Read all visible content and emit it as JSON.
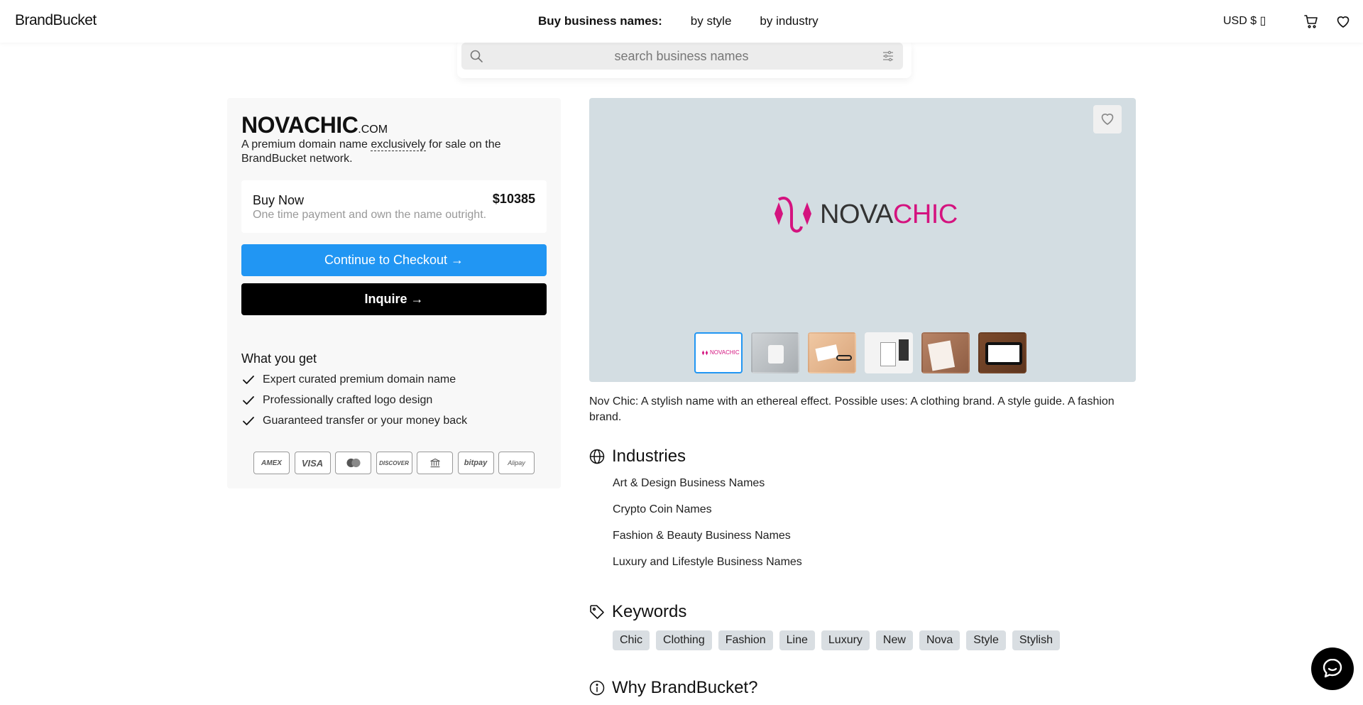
{
  "header": {
    "logo": "BrandBucket",
    "nav_title": "Buy business names:",
    "nav_links": [
      "by style",
      "by industry"
    ],
    "currency": "USD $ ▯"
  },
  "search": {
    "placeholder": "search business names"
  },
  "domain": {
    "name": "NOVACHIC",
    "tld": ".COM",
    "desc_before": "A premium domain name ",
    "desc_emph": "exclusively",
    "desc_after": " for sale on the BrandBucket network."
  },
  "buy": {
    "label": "Buy Now",
    "price": "$10385",
    "sub": "One time payment and own the name outright."
  },
  "buttons": {
    "checkout": "Continue to Checkout →",
    "inquire": "Inquire →"
  },
  "what_you_get": {
    "title": "What you get",
    "items": [
      "Expert curated premium domain name",
      "Professionally crafted logo design",
      "Guaranteed transfer or your money back"
    ]
  },
  "payments": [
    "AMEX",
    "VISA",
    "",
    "DISCOVER",
    "",
    "bitpay",
    "Alipay"
  ],
  "gallery": {
    "wordmark_a": "NOVA",
    "wordmark_b": "CHIC",
    "thumb_logo": "NOVACHIC"
  },
  "description": "Nov Chic: A stylish name with an ethereal effect. Possible uses: A clothing brand. A style guide. A fashion brand.",
  "industries": {
    "title": "Industries",
    "items": [
      "Art & Design Business Names",
      "Crypto Coin Names",
      "Fashion & Beauty Business Names",
      "Luxury and Lifestyle Business Names"
    ]
  },
  "keywords": {
    "title": "Keywords",
    "items": [
      "Chic",
      "Clothing",
      "Fashion",
      "Line",
      "Luxury",
      "New",
      "Nova",
      "Style",
      "Stylish"
    ]
  },
  "why": {
    "title": "Why BrandBucket?"
  },
  "colors": {
    "accent_blue": "#2196f3",
    "brand_pink": "#d4137f",
    "gallery_bg": "#d3dde2"
  }
}
